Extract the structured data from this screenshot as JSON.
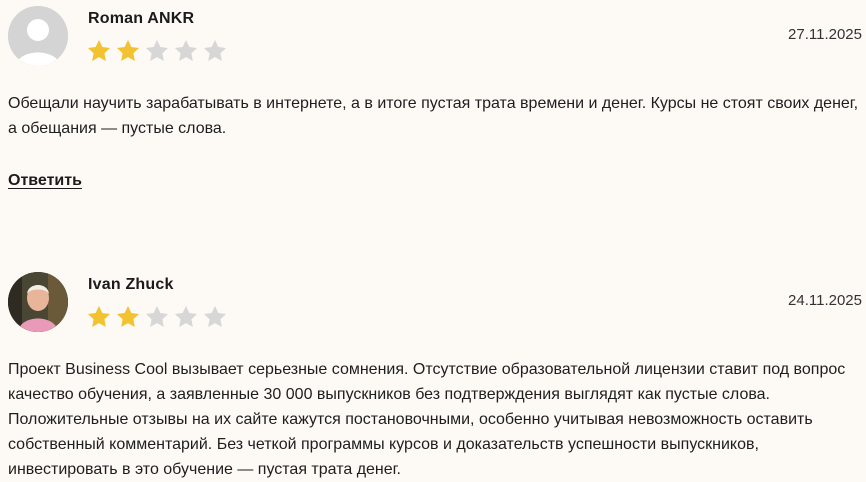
{
  "reviews": [
    {
      "author": "Roman ANKR",
      "rating": 2,
      "max_rating": 5,
      "date": "27.11.2025",
      "text": "Обещали научить зарабатывать в интернете, а в итоге пустая трата времени и денег. Курсы не стоят своих денег, а обещания — пустые слова.",
      "reply_label": "Ответить",
      "avatar": "default-user-icon"
    },
    {
      "author": "Ivan Zhuck",
      "rating": 2,
      "max_rating": 5,
      "date": "24.11.2025",
      "text": "Проект Business Cool вызывает серьезные сомнения. Отсутствие образовательной лицензии ставит под вопрос качество обучения, а заявленные 30 000 выпускников без подтверждения выглядят как пустые слова. Положительные отзывы на их сайте кажутся постановочными, особенно учитывая невозможность оставить собственный комментарий. Без четкой программы курсов и доказательств успешности выпускников, инвестировать в это обучение — пустая трата денег.",
      "avatar": "user-photo"
    }
  ],
  "colors": {
    "background": "#fdfaf6",
    "star_filled": "#f2c230",
    "star_empty": "#d7d7d7"
  }
}
